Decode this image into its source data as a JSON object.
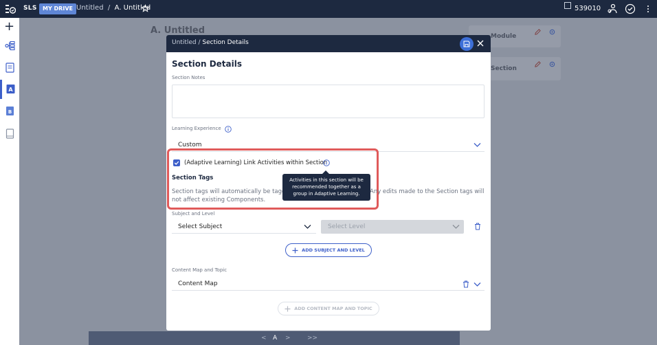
{
  "topbar": {
    "app_name": "SLS",
    "drive_label": "MY DRIVE",
    "crumb_parent": "Untitled",
    "crumb_sep": "/",
    "crumb_current": "A. Untitled",
    "user_id": "539010"
  },
  "page": {
    "title": "A. Untitled",
    "bg_card_module": "Module",
    "bg_card_section": "Section",
    "bottom_nav": [
      "<",
      "A",
      ">",
      ">>"
    ]
  },
  "modal": {
    "breadcrumb_parent": "Untitled",
    "breadcrumb_sep": " / ",
    "breadcrumb_current": "Section Details",
    "heading": "Section Details",
    "section_notes_label": "Section Notes",
    "section_notes_value": "",
    "learning_experience_label": "Learning Experience",
    "learning_experience_value": "Custom",
    "adaptive_checkbox_label": "(Adaptive Learning) Link Activities within Section",
    "adaptive_checked": true,
    "tooltip_lines": [
      "Activities in this section will be",
      "recommended together as a",
      "group in Adaptive Learning."
    ],
    "section_tags_heading": "Section Tags",
    "section_tags_desc_left": "Section tags will automatically be tagge",
    "section_tags_desc_right": "Any edits made to the Section tags will",
    "section_tags_desc_line2": "not affect existing Components.",
    "subject_level_label": "Subject and Level",
    "select_subject_placeholder": "Select Subject",
    "select_level_placeholder": "Select Level",
    "add_subject_level_label": "ADD SUBJECT AND LEVEL",
    "content_map_label": "Content Map and Topic",
    "content_map_value": "Content Map",
    "add_content_map_label": "ADD CONTENT MAP AND TOPIC"
  },
  "colors": {
    "navy": "#1d2940",
    "accent": "#3d5fc9",
    "highlight": "#e05a5a"
  }
}
